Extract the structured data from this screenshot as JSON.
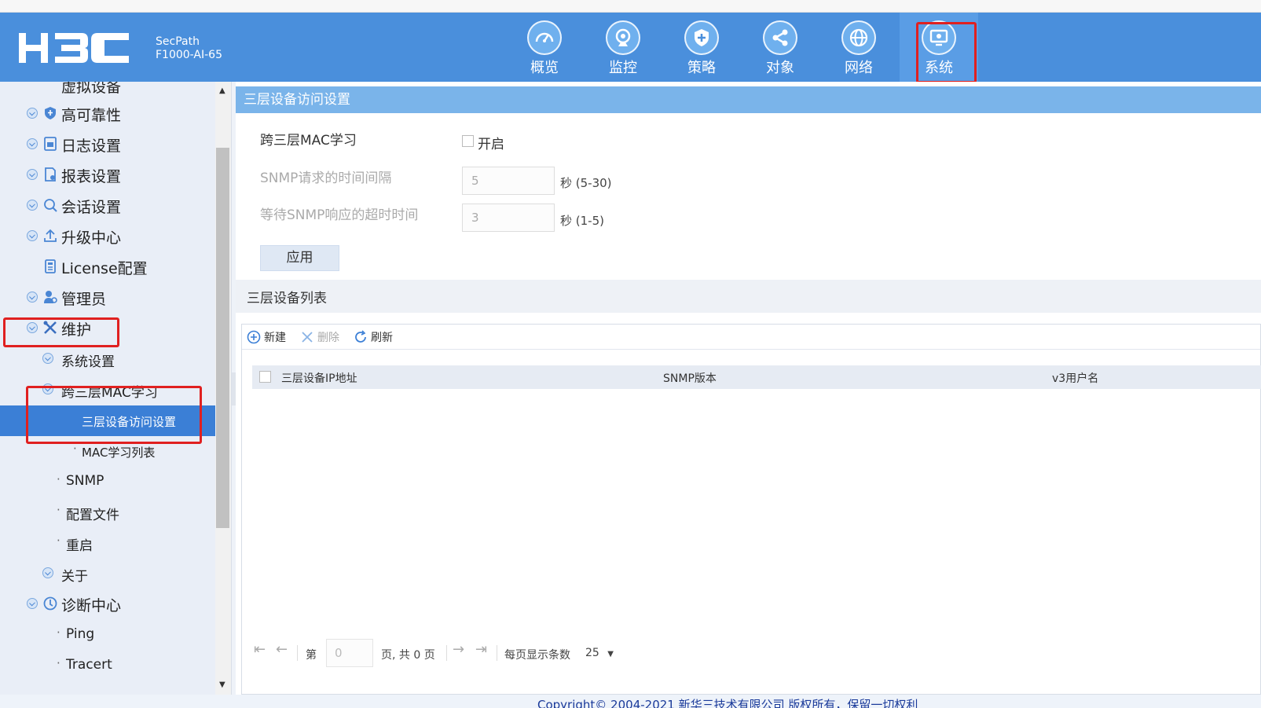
{
  "header": {
    "logo_text": "H3C",
    "product_line1": "SecPath",
    "product_line2": "F1000-AI-65",
    "nav": [
      {
        "label": "概览",
        "icon": "dashboard-icon"
      },
      {
        "label": "监控",
        "icon": "monitor-icon"
      },
      {
        "label": "策略",
        "icon": "shield-icon"
      },
      {
        "label": "对象",
        "icon": "share-icon"
      },
      {
        "label": "网络",
        "icon": "globe-icon"
      },
      {
        "label": "系统",
        "icon": "system-icon",
        "active": true
      }
    ]
  },
  "sidebar": {
    "partial_top": "虚拟设备",
    "items": [
      {
        "label": "高可靠性",
        "icon": "shield-icon"
      },
      {
        "label": "日志设置",
        "icon": "log-icon"
      },
      {
        "label": "报表设置",
        "icon": "report-icon"
      },
      {
        "label": "会话设置",
        "icon": "session-icon"
      },
      {
        "label": "升级中心",
        "icon": "upload-icon"
      },
      {
        "label": "License配置",
        "icon": "license-icon"
      },
      {
        "label": "管理员",
        "icon": "admin-icon"
      },
      {
        "label": "维护",
        "icon": "tools-icon"
      },
      {
        "label": "系统设置"
      },
      {
        "label": "跨三层MAC学习"
      },
      {
        "label": "三层设备访问设置",
        "selected": true
      },
      {
        "label": "MAC学习列表"
      },
      {
        "label": "SNMP"
      },
      {
        "label": "配置文件"
      },
      {
        "label": "重启"
      },
      {
        "label": "关于"
      },
      {
        "label": "诊断中心",
        "icon": "diagnose-icon"
      },
      {
        "label": "Ping"
      },
      {
        "label": "Tracert"
      }
    ]
  },
  "main": {
    "title": "三层设备访问设置",
    "form": {
      "mac_learning_label": "跨三层MAC学习",
      "mac_learning_option": "开启",
      "snmp_interval_label": "SNMP请求的时间间隔",
      "snmp_interval_value": "5",
      "snmp_interval_unit": "秒 (5-30)",
      "snmp_timeout_label": "等待SNMP响应的超时时间",
      "snmp_timeout_value": "3",
      "snmp_timeout_unit": "秒 (1-5)",
      "apply_label": "应用"
    },
    "list": {
      "title": "三层设备列表",
      "toolbar": {
        "new": "新建",
        "delete": "删除",
        "refresh": "刷新"
      },
      "columns": [
        "三层设备IP地址",
        "SNMP版本",
        "v3用户名"
      ],
      "pager": {
        "page_prefix": "第",
        "page_value": "0",
        "page_suffix": "页, 共 0 页",
        "per_page_label": "每页显示条数",
        "per_page_value": "25"
      }
    }
  },
  "footer": {
    "copyright": "Copyright© 2004-2021 新华三技术有限公司 版权所有，保留一切权利"
  },
  "colors": {
    "header_bg": "#4a8fdc",
    "sidebar_bg": "#e9eef7",
    "selected_bg": "#3b7fd6",
    "title_band": "#7ab4ea",
    "highlight": "#e02020"
  }
}
